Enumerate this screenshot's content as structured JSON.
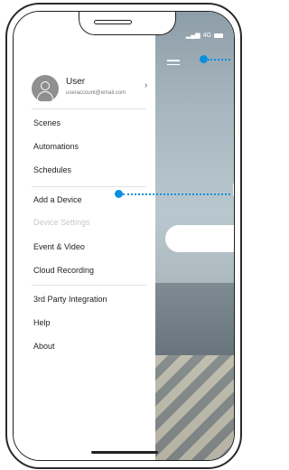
{
  "status": {
    "network": "4G"
  },
  "user": {
    "name": "User",
    "email": "useraccount@email.com"
  },
  "menu": {
    "group1": [
      "Scenes",
      "Automations",
      "Schedules"
    ],
    "group2": [
      "Add a Device",
      "Device Settings",
      "Event & Video",
      "Cloud Recording"
    ],
    "group3": [
      "3rd Party Integration",
      "Help",
      "About"
    ]
  },
  "colors": {
    "accent": "#0a8fe0"
  },
  "icons": {
    "avatar": "user-avatar-icon",
    "chevron": "chevron-right-icon",
    "app_menu": "hamburger-menu-icon",
    "battery": "battery-icon",
    "signal": "signal-icon"
  }
}
